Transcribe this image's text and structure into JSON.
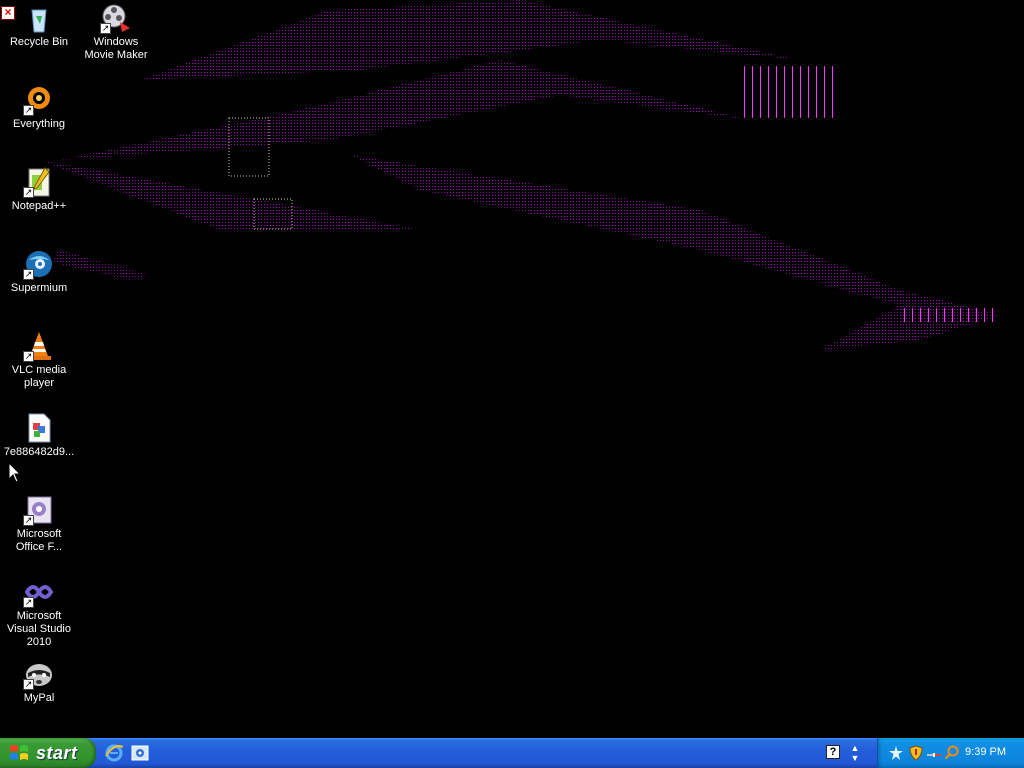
{
  "desktop": {
    "icons": [
      {
        "label": "Recycle Bin",
        "icon": "recycle-bin-icon"
      },
      {
        "label": "Windows Movie Maker",
        "icon": "movie-maker-icon"
      },
      {
        "label": "Everything",
        "icon": "everything-search-icon"
      },
      {
        "label": "Notepad++",
        "icon": "notepad-plus-plus-icon"
      },
      {
        "label": "Supermium",
        "icon": "supermium-browser-icon"
      },
      {
        "label": "VLC media player",
        "icon": "vlc-cone-icon"
      },
      {
        "label": "7e886482d9...",
        "icon": "image-file-icon"
      },
      {
        "label": "Microsoft Office F...",
        "icon": "office-tool-icon"
      },
      {
        "label": "Microsoft Visual Studio 2010",
        "icon": "visual-studio-icon"
      },
      {
        "label": "MyPal",
        "icon": "mypal-raccoon-icon"
      }
    ]
  },
  "taskbar": {
    "start_label": "start",
    "clock": "9:39 PM",
    "help_glyph": "?",
    "expand_glyph": "▲▼"
  },
  "colors": {
    "taskbar": "#245edb",
    "start": "#3a9a36",
    "tray": "#0f8ee3",
    "art": "#b000c8"
  }
}
